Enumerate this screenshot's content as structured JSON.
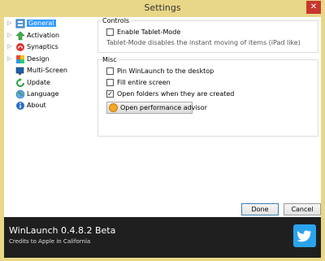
{
  "window": {
    "title": "Settings",
    "close_glyph": "✕"
  },
  "sidebar": {
    "items": [
      {
        "label": "General",
        "icon": "general-icon",
        "selected": true
      },
      {
        "label": "Activation",
        "icon": "activation-arrow-icon",
        "selected": false
      },
      {
        "label": "Synaptics",
        "icon": "synaptics-icon",
        "selected": false
      },
      {
        "label": "Design",
        "icon": "design-icon",
        "selected": false
      },
      {
        "label": "Multi-Screen",
        "icon": "multi-screen-icon",
        "selected": false
      },
      {
        "label": "Update",
        "icon": "update-icon",
        "selected": false
      },
      {
        "label": "Language",
        "icon": "language-globe-icon",
        "selected": false
      },
      {
        "label": "About",
        "icon": "info-icon",
        "selected": false
      }
    ],
    "expander_glyph": "▷"
  },
  "controls_group": {
    "title": "Controls",
    "tablet_mode": {
      "label": "Enable Tablet-Mode",
      "checked": false
    },
    "hint": "Tablet-Mode disables the instant moving of items (iPad like)"
  },
  "misc_group": {
    "title": "Misc",
    "pin": {
      "label": "Pin WinLaunch to the desktop",
      "checked": false
    },
    "fill": {
      "label": "Fill entire screen",
      "checked": false
    },
    "open_folders": {
      "label": "Open folders when they are created",
      "checked": true,
      "check_glyph": "✓"
    },
    "perf_button": "Open performance advisor"
  },
  "buttons": {
    "done": "Done",
    "cancel": "Cancel"
  },
  "footer": {
    "app_name": "WinLaunch 0.4.8.2 Beta",
    "credits": "Credits to Apple in California",
    "icon": "twitter-icon"
  },
  "colors": {
    "frame": "#e9d788",
    "selection": "#3399ff",
    "footer_bg": "#1f1f1f",
    "twitter": "#2aa3ef"
  }
}
